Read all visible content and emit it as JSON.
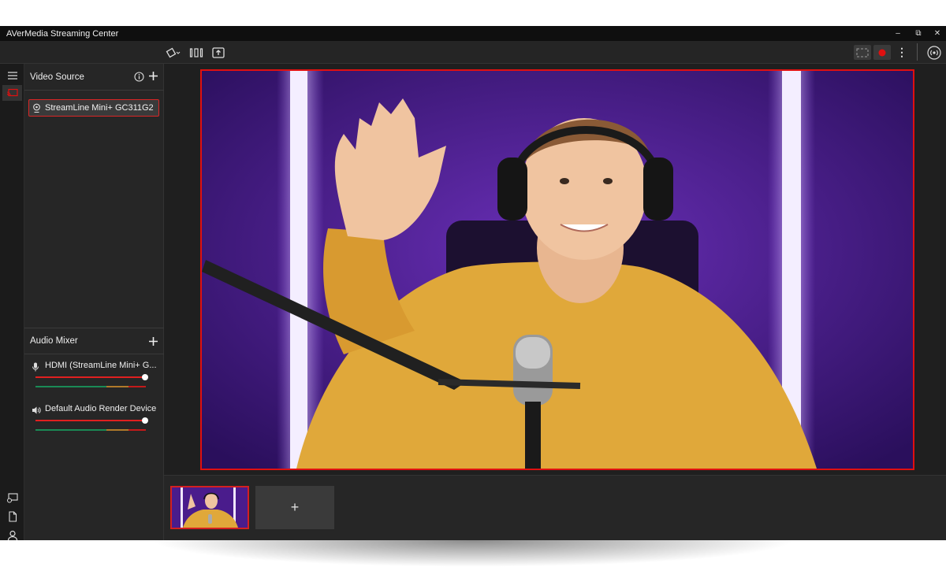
{
  "window": {
    "title": "AVerMedia Streaming Center",
    "minimize_glyph": "–",
    "restore_glyph": "⧉",
    "close_glyph": "✕"
  },
  "toolbar": {
    "icons": [
      "rotate-icon",
      "split-view-icon",
      "upload-icon"
    ],
    "right_icons": [
      "screenshot-icon",
      "record-icon",
      "more-icon",
      "broadcast-icon"
    ],
    "record_color": "#e01010"
  },
  "rail": {
    "icons": [
      "menu-icon",
      "video-source-icon",
      "camera-settings-icon",
      "document-icon",
      "user-icon",
      "settings-icon"
    ]
  },
  "video_source": {
    "heading": "Video Source",
    "sources": [
      {
        "label": "StreamLine Mini+ GC311G2",
        "icon": "webcam-icon"
      }
    ]
  },
  "audio_mixer": {
    "heading": "Audio Mixer",
    "channels": [
      {
        "name": "HDMI (StreamLine Mini+ G...",
        "icon": "microphone-icon",
        "volume": 1.0
      },
      {
        "name": "Default Audio Render Device",
        "icon": "speaker-icon",
        "volume": 1.0
      }
    ]
  },
  "scenes": {
    "add_label": "+"
  },
  "colors": {
    "accent": "#e01010",
    "background": "#1f1f1f",
    "panel": "#262626"
  }
}
